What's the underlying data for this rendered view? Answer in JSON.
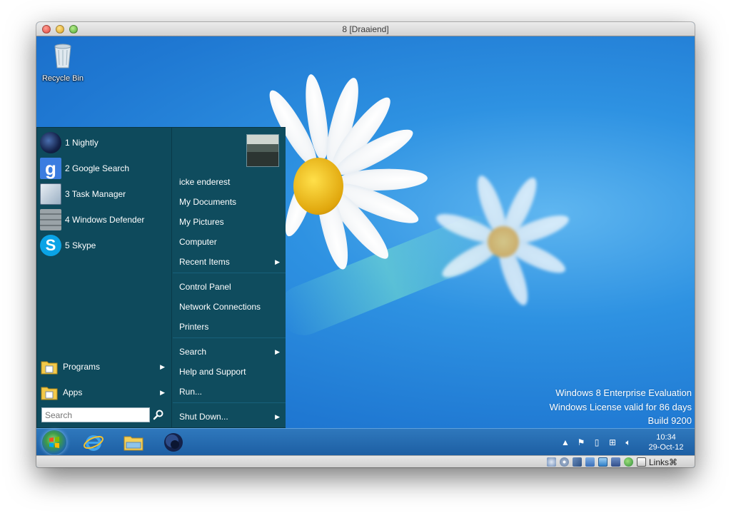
{
  "window": {
    "title": "8 [Draaiend]"
  },
  "desktop": {
    "icons": [
      {
        "label": "Recycle Bin",
        "icon": "recycle-bin-icon"
      }
    ],
    "watermark": {
      "line1": "Windows 8 Enterprise Evaluation",
      "line2": "Windows License valid for 86 days",
      "line3": "Build 9200"
    }
  },
  "start_menu": {
    "pinned": [
      {
        "label": "1 Nightly",
        "icon": "nightly-icon"
      },
      {
        "label": "2 Google Search",
        "icon": "google-icon"
      },
      {
        "label": "3 Task Manager",
        "icon": "task-manager-icon"
      },
      {
        "label": "4 Windows Defender",
        "icon": "windows-defender-icon"
      },
      {
        "label": "5 Skype",
        "icon": "skype-icon"
      }
    ],
    "programs_label": "Programs",
    "apps_label": "Apps",
    "search_placeholder": "Search",
    "right": {
      "user": "icke enderest",
      "my_documents": "My Documents",
      "my_pictures": "My Pictures",
      "computer": "Computer",
      "recent_items": "Recent Items",
      "control_panel": "Control Panel",
      "network_connections": "Network Connections",
      "printers": "Printers",
      "search": "Search",
      "help_and_support": "Help and Support",
      "run": "Run...",
      "shut_down": "Shut Down..."
    }
  },
  "taskbar": {
    "apps": [
      "internet-explorer-icon",
      "file-explorer-icon",
      "nightly-icon"
    ],
    "tray": [
      "show-hidden-icons",
      "action-center-flag-icon",
      "device-icon",
      "network-icon",
      "volume-icon"
    ],
    "clock_time": "10:34",
    "clock_date": "29-Oct-12"
  },
  "vm_status": {
    "links_label": "Links⌘"
  },
  "colors": {
    "start_menu_bg": "#0e4a5c",
    "taskbar_bg": "#2469ad",
    "desktop_bg": "#2a8ae0"
  }
}
